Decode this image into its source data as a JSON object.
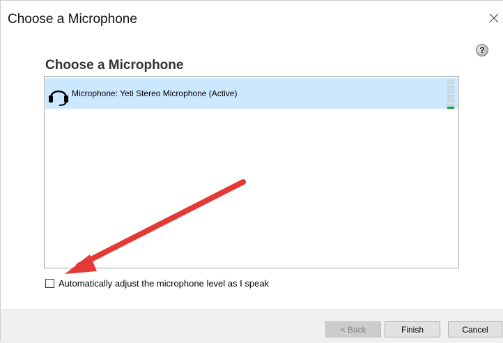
{
  "window": {
    "title": "Choose a Microphone",
    "close_icon": "close-icon"
  },
  "help": {
    "label": "?"
  },
  "heading": "Choose a Microphone",
  "devices": [
    {
      "label": "Microphone: Yeti Stereo Microphone (Active)",
      "icon": "headset-icon",
      "selected": true,
      "level": 0.1
    }
  ],
  "auto_adjust": {
    "label": "Automatically adjust the microphone level as I speak",
    "checked": false
  },
  "buttons": {
    "back": "< Back",
    "finish": "Finish",
    "cancel": "Cancel"
  },
  "annotation": {
    "arrow_color": "#e53935"
  },
  "colors": {
    "selection": "#cce8ff",
    "level_on": "#1f9a2f"
  }
}
